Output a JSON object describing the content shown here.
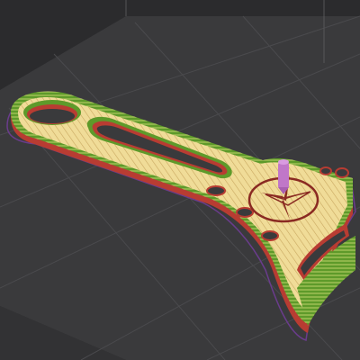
{
  "app": {
    "view": "3d-slice-preview"
  },
  "scene": {
    "background_color": "#2b2b2d",
    "bed_color": "#3a3a3c",
    "grid_line_color": "#4a4a4d",
    "skirt_color": "#6a3c8c",
    "outer_wall_color": "#b83c32",
    "inner_wall_color": "#5e9a2a",
    "infill_color": "#f0dc98",
    "infill_line_color": "#c9a860",
    "logo_color": "#8a2a22",
    "nozzle_color": "#c077c8",
    "icons": [
      "print-part-icon",
      "nozzle-icon",
      "mercedes-star-icon"
    ]
  }
}
